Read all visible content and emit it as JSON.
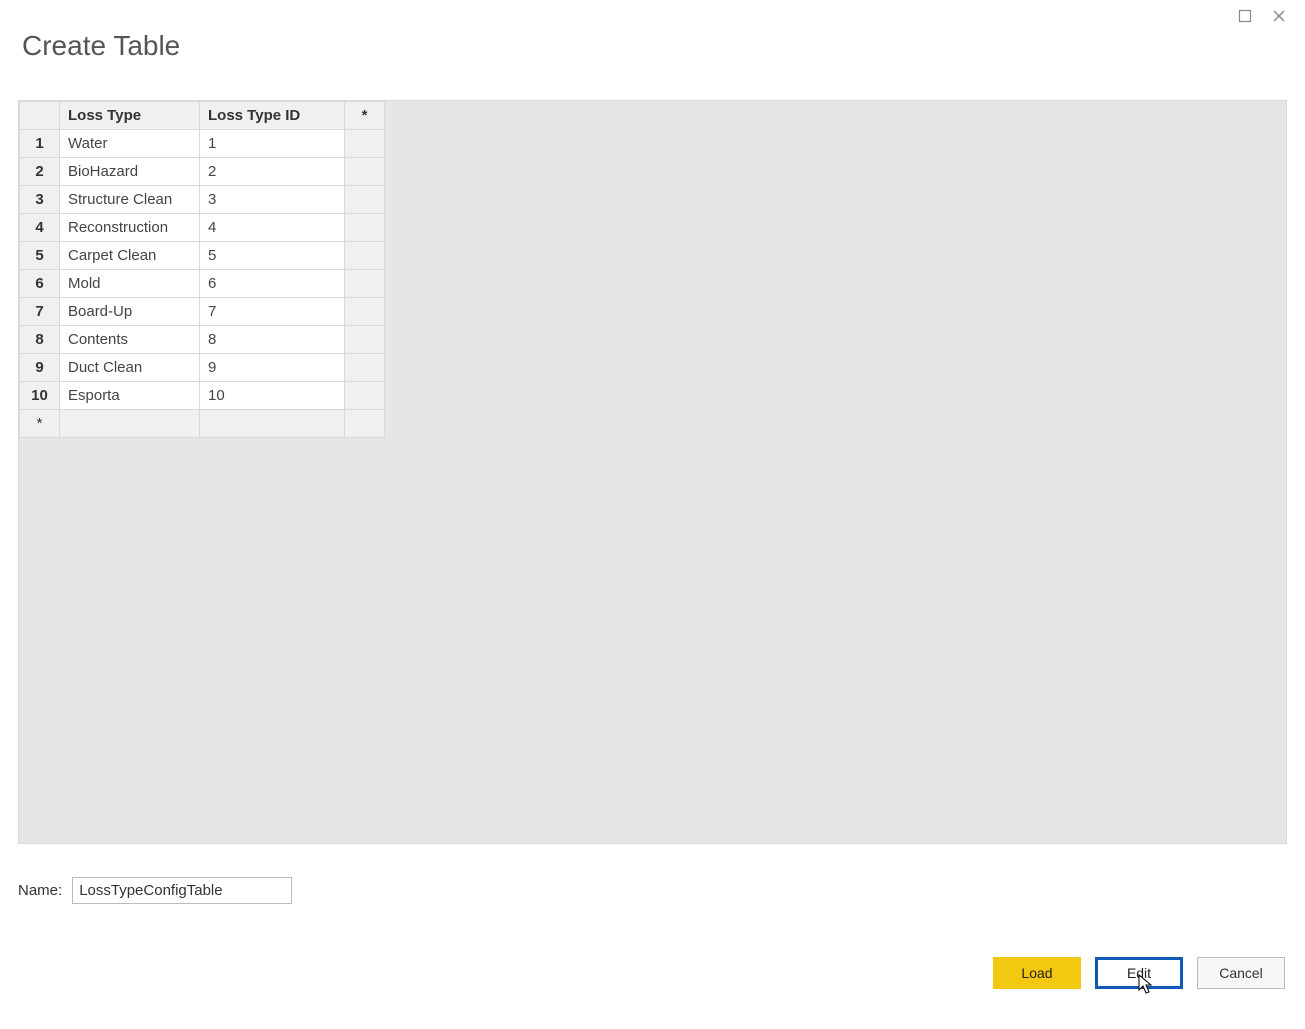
{
  "dialog": {
    "title": "Create Table"
  },
  "table": {
    "headers": {
      "col1": "Loss Type",
      "col2": "Loss Type ID",
      "col3": "*"
    },
    "rows": [
      {
        "num": "1",
        "loss": "Water",
        "id": "1"
      },
      {
        "num": "2",
        "loss": "BioHazard",
        "id": "2"
      },
      {
        "num": "3",
        "loss": "Structure Clean",
        "id": "3"
      },
      {
        "num": "4",
        "loss": "Reconstruction",
        "id": "4"
      },
      {
        "num": "5",
        "loss": "Carpet Clean",
        "id": "5"
      },
      {
        "num": "6",
        "loss": "Mold",
        "id": "6"
      },
      {
        "num": "7",
        "loss": "Board-Up",
        "id": "7"
      },
      {
        "num": "8",
        "loss": "Contents",
        "id": "8"
      },
      {
        "num": "9",
        "loss": "Duct Clean",
        "id": "9"
      },
      {
        "num": "10",
        "loss": "Esporta",
        "id": "10"
      }
    ],
    "newRowMarker": "*"
  },
  "name": {
    "label": "Name:",
    "value": "LossTypeConfigTable"
  },
  "buttons": {
    "load": "Load",
    "edit": "Edit",
    "cancel": "Cancel"
  }
}
